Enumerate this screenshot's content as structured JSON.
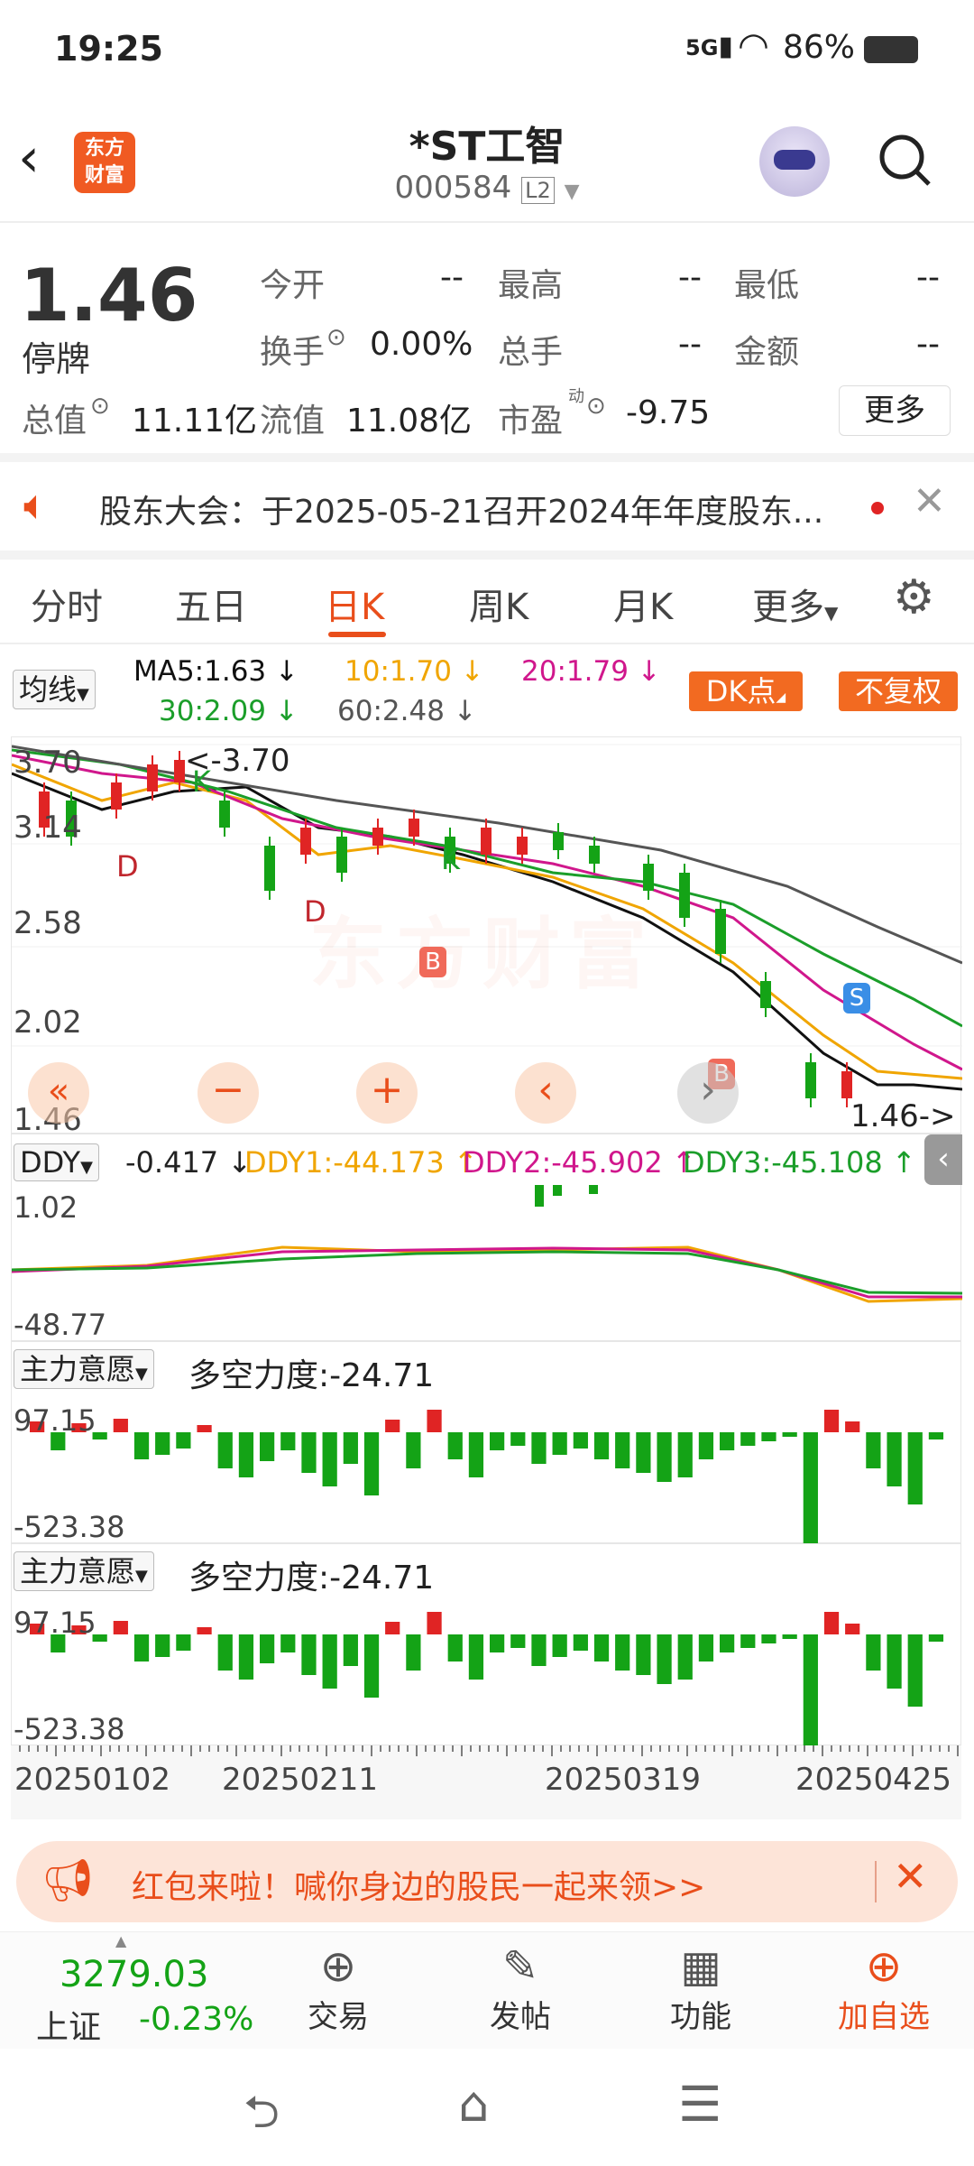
{
  "status_bar": {
    "time": "19:25",
    "signal": "5G",
    "battery": "86%"
  },
  "header": {
    "logo_line1": "东方",
    "logo_line2": "财富",
    "stock_name": "*ST工智",
    "stock_code": "000584",
    "level": "L2"
  },
  "quote": {
    "price": "1.46",
    "status": "停牌",
    "open_label": "今开",
    "open": "--",
    "high_label": "最高",
    "high": "--",
    "low_label": "最低",
    "low": "--",
    "turnover_label": "换手",
    "turnover": "0.00%",
    "volume_label": "总手",
    "volume": "--",
    "amount_label": "金额",
    "amount": "--",
    "mktcap_label": "总值",
    "mktcap": "11.11亿",
    "float_label": "流值",
    "float": "11.08亿",
    "pe_label": "市盈",
    "pe_sup": "动",
    "pe": "-9.75",
    "more": "更多"
  },
  "notice": {
    "text": "股东大会：于2025-05-21召开2024年年度股东..."
  },
  "tabs": [
    "分时",
    "五日",
    "日K",
    "周K",
    "月K",
    "更多"
  ],
  "active_tab": "日K",
  "ma": {
    "selector": "均线",
    "ma5": "MA5:1.63",
    "ma10": "10:1.70",
    "ma20": "20:1.79",
    "ma30": "30:2.09",
    "ma60": "60:2.48",
    "dk_button": "DK点",
    "adjust_button": "不复权"
  },
  "kchart": {
    "y_labels": [
      "3.70",
      "3.14",
      "2.58",
      "2.02",
      "1.46"
    ],
    "max_annot": "<-3.70",
    "last_annot": "1.46->",
    "markers": [
      "K",
      "K",
      "D",
      "D",
      "B",
      "B",
      "S"
    ]
  },
  "ddy": {
    "selector": "DDY",
    "value": "-0.417",
    "ddy1": "DDY1:-44.173",
    "ddy2": "DDY2:-45.902",
    "ddy3": "DDY3:-45.108",
    "y_top": "1.02",
    "y_bottom": "-48.77"
  },
  "force1": {
    "selector": "主力意愿",
    "value": "多空力度:-24.71",
    "y_top": "97.15",
    "y_bottom": "-523.38"
  },
  "force2": {
    "selector": "主力意愿",
    "value": "多空力度:-24.71",
    "y_top": "97.15",
    "y_bottom": "-523.38"
  },
  "x_dates": [
    "20250102",
    "20250211",
    "20250319",
    "20250425"
  ],
  "banner": {
    "text": "红包来啦！喊你身边的股民一起来领>>"
  },
  "bottom_nav": {
    "index_value": "3279.03",
    "index_name": "上证",
    "index_change": "-0.23%",
    "trade": "交易",
    "post": "发帖",
    "functions": "功能",
    "add": "加自选"
  },
  "colors": {
    "accent": "#e94e1b",
    "up": "#e02424",
    "down": "#14a316",
    "ma5": "#111111",
    "ma10": "#f0a500",
    "ma20": "#d0178c",
    "ma30": "#1b9e2a",
    "ma60": "#555555"
  }
}
